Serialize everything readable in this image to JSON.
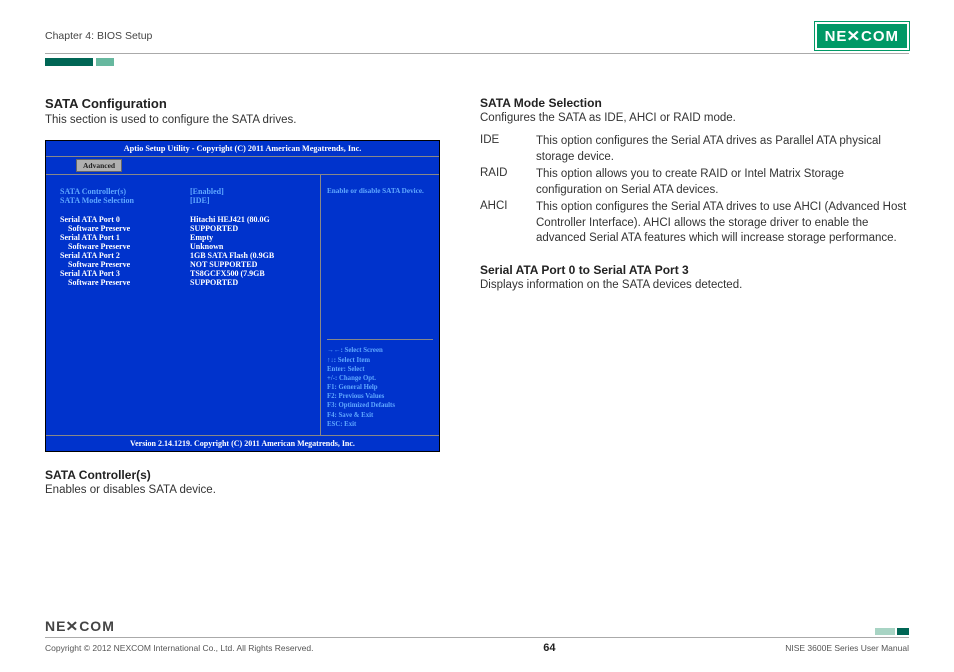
{
  "header": {
    "chapter": "Chapter 4: BIOS Setup",
    "logo_text": "NE COM"
  },
  "left": {
    "title": "SATA Configuration",
    "desc": "This section is used to configure the SATA drives.",
    "bios": {
      "top": "Aptio Setup Utility - Copyright (C) 2011 American Megatrends, Inc.",
      "tab_active": "Advanced",
      "opts": [
        {
          "label": "SATA Controller(s)",
          "value": "[Enabled]",
          "cls": "blue-opt"
        },
        {
          "label": "SATA Mode Selection",
          "value": "[IDE]",
          "cls": "blue-opt"
        }
      ],
      "ports": [
        {
          "label": "Serial ATA Port 0",
          "value": "Hitachi HEJ421  (80.0G"
        },
        {
          "label": "Software Preserve",
          "value": "SUPPORTED",
          "indent": true
        },
        {
          "label": "Serial ATA Port 1",
          "value": "Empty"
        },
        {
          "label": "Software Preserve",
          "value": "Unknown",
          "indent": true
        },
        {
          "label": "Serial ATA Port 2",
          "value": "1GB SATA Flash  (0.9GB"
        },
        {
          "label": "Software Preserve",
          "value": "NOT SUPPORTED",
          "indent": true
        },
        {
          "label": "Serial ATA Port 3",
          "value": "TS8GCFX500     (7.9GB"
        },
        {
          "label": "Software Preserve",
          "value": "SUPPORTED",
          "indent": true
        }
      ],
      "help": "Enable or disable SATA Device.",
      "keys": [
        "→←: Select Screen",
        "↑↓: Select Item",
        "Enter: Select",
        "+/-: Change Opt.",
        "F1: General Help",
        "F2: Previous Values",
        "F3: Optimized Defaults",
        "F4: Save & Exit",
        "ESC: Exit"
      ],
      "bottom": "Version 2.14.1219. Copyright (C) 2011 American Megatrends, Inc."
    },
    "sub1_title": "SATA Controller(s)",
    "sub1_desc": "Enables or disables SATA device."
  },
  "right": {
    "sub1_title": "SATA Mode Selection",
    "sub1_desc": "Configures the SATA as IDE, AHCI or RAID mode.",
    "modes": [
      {
        "key": "IDE",
        "val": "This option configures the Serial ATA drives as Parallel ATA physical  storage device."
      },
      {
        "key": "RAID",
        "val": "This option allows you to create RAID or Intel Matrix Storage configuration on Serial ATA devices."
      },
      {
        "key": "AHCI",
        "val": "This option configures the Serial ATA drives to use AHCI (Advanced Host Controller Interface). AHCI allows the storage driver to enable the advanced Serial ATA features which will increase storage performance."
      }
    ],
    "sub2_title": "Serial ATA Port 0 to Serial ATA Port 3",
    "sub2_desc": "Displays information on the SATA devices detected."
  },
  "footer": {
    "copyright": "Copyright © 2012 NEXCOM International Co., Ltd. All Rights Reserved.",
    "page": "64",
    "manual": "NISE 3600E Series User Manual",
    "logo": "NE COM"
  }
}
